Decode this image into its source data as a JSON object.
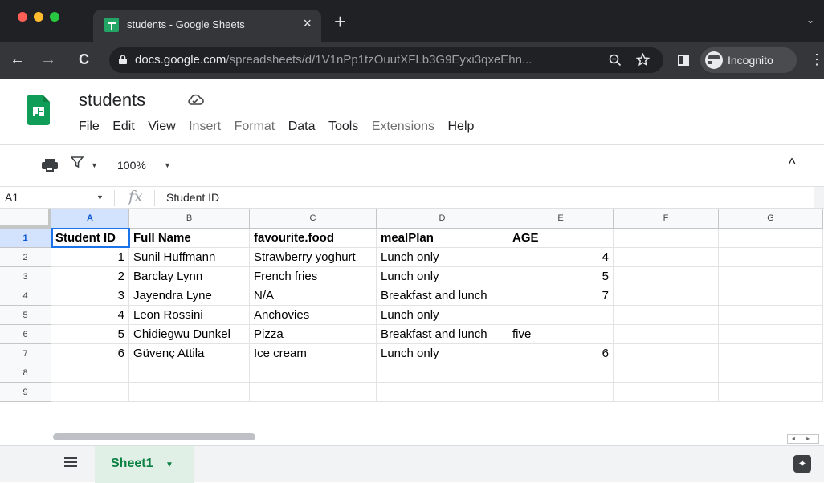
{
  "browser": {
    "tab_title": "students - Google Sheets",
    "tab_close": "×",
    "new_tab": "+",
    "tabs_menu": "⌄",
    "back": "←",
    "forward": "→",
    "reload": "C",
    "url_host": "docs.google.com",
    "url_path": "/spreadsheets/d/1V1nPp1tzOuutXFLb3G9Eyxi3qxeEhn...",
    "incognito_label": "Incognito",
    "menu": "⋮",
    "colors": {
      "tabstrip": "#202124",
      "toolbar": "#35363a",
      "red": "#ff5f57",
      "yellow": "#febc2e",
      "green": "#28c840"
    }
  },
  "doc": {
    "title": "students",
    "menu": [
      "File",
      "Edit",
      "View",
      "Insert",
      "Format",
      "Data",
      "Tools",
      "Extensions",
      "Help"
    ],
    "menu_dim": [
      false,
      false,
      false,
      true,
      true,
      false,
      false,
      true,
      false
    ]
  },
  "toolbar": {
    "zoom": "100%",
    "caret": "▼",
    "collapse": "^"
  },
  "formula_bar": {
    "name_box": "A1",
    "fx": "fx",
    "value": "Student ID"
  },
  "grid": {
    "columns": [
      "A",
      "B",
      "C",
      "D",
      "E",
      "F",
      "G"
    ],
    "rows": [
      "1",
      "2",
      "3",
      "4",
      "5",
      "6",
      "7",
      "8",
      "9"
    ],
    "cells": [
      [
        "Student ID",
        "Full Name",
        "favourite.food",
        "mealPlan",
        "AGE",
        "",
        ""
      ],
      [
        "1",
        "Sunil Huffmann",
        "Strawberry yoghurt",
        "Lunch only",
        "4",
        "",
        ""
      ],
      [
        "2",
        "Barclay Lynn",
        "French fries",
        "Lunch only",
        "5",
        "",
        ""
      ],
      [
        "3",
        "Jayendra Lyne",
        "N/A",
        "Breakfast and lunch",
        "7",
        "",
        ""
      ],
      [
        "4",
        "Leon Rossini",
        "Anchovies",
        "Lunch only",
        "",
        "",
        ""
      ],
      [
        "5",
        "Chidiegwu Dunkel",
        "Pizza",
        "Breakfast and lunch",
        "five",
        "",
        ""
      ],
      [
        "6",
        "Güvenç Attila",
        "Ice cream",
        "Lunch only",
        "6",
        "",
        ""
      ],
      [
        "",
        "",
        "",
        "",
        "",
        "",
        ""
      ],
      [
        "",
        "",
        "",
        "",
        "",
        "",
        ""
      ]
    ],
    "selected_cell": "A1"
  },
  "sheets_bar": {
    "active_sheet": "Sheet1",
    "scroll_arrows": "◂ ▸"
  }
}
